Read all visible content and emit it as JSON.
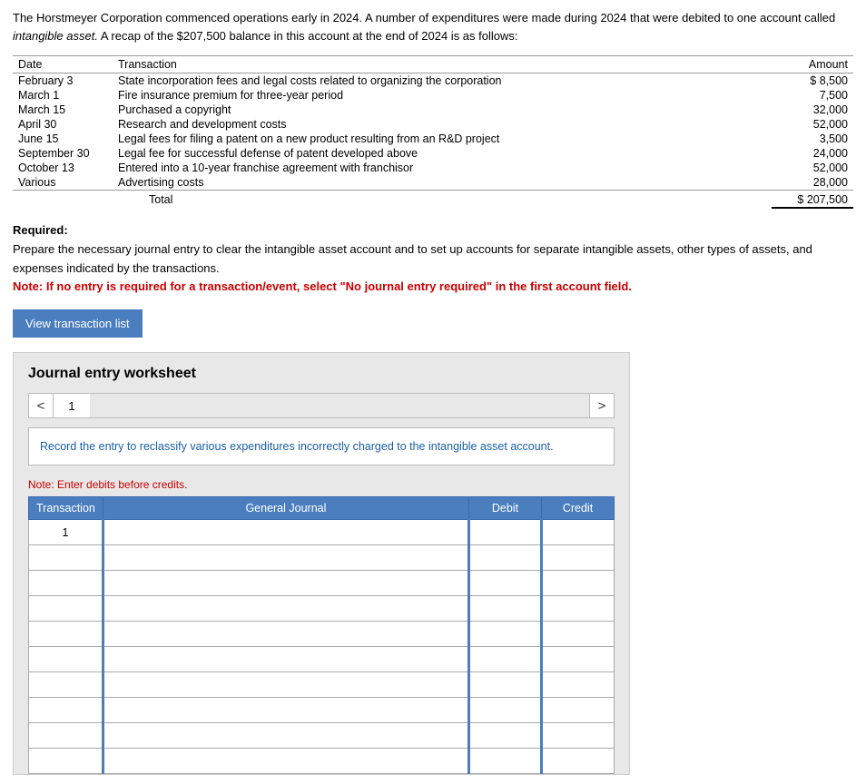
{
  "intro": {
    "text": "The Horstmeyer Corporation commenced operations early in 2024. A number of expenditures were made during 2024 that were debited to one account called intangible asset. A recap of the $207,500 balance in this account at the end of 2024 is as follows:"
  },
  "transaction_table": {
    "headers": [
      "Date",
      "Transaction",
      "Amount"
    ],
    "rows": [
      {
        "date": "February 3",
        "transaction": "State incorporation fees and legal costs related to organizing the corporation",
        "amount": "$ 8,500"
      },
      {
        "date": "March 1",
        "transaction": "Fire insurance premium for three-year period",
        "amount": "7,500"
      },
      {
        "date": "March 15",
        "transaction": "Purchased a copyright",
        "amount": "32,000"
      },
      {
        "date": "April 30",
        "transaction": "Research and development costs",
        "amount": "52,000"
      },
      {
        "date": "June 15",
        "transaction": "Legal fees for filing a patent on a new product resulting from an R&D project",
        "amount": "3,500"
      },
      {
        "date": "September 30",
        "transaction": "Legal fee for successful defense of patent developed above",
        "amount": "24,000"
      },
      {
        "date": "October 13",
        "transaction": "Entered into a 10-year franchise agreement with franchisor",
        "amount": "52,000"
      },
      {
        "date": "Various",
        "transaction": "Advertising costs",
        "amount": "28,000"
      }
    ],
    "total_label": "Total",
    "total_amount": "$ 207,500"
  },
  "required": {
    "label": "Required:",
    "text": "Prepare the necessary journal entry to clear the intangible asset account and to set up accounts for separate intangible assets, other types of assets, and expenses indicated by the transactions.",
    "note": "Note: If no entry is required for a transaction/event, select \"No journal entry required\" in the first account field."
  },
  "view_btn": {
    "label": "View transaction list"
  },
  "worksheet": {
    "title": "Journal entry worksheet",
    "nav": {
      "left_arrow": "<",
      "page_number": "1",
      "right_arrow": ">"
    },
    "description": {
      "part1": "Record the entry to reclassify various expenditures incorrectly charged to the",
      "part2": "intangible asset account."
    },
    "note": "Note: Enter debits before credits.",
    "table": {
      "headers": [
        "Transaction",
        "General Journal",
        "Debit",
        "Credit"
      ],
      "rows": [
        {
          "transaction": "1",
          "gj": "",
          "debit": "",
          "credit": ""
        },
        {
          "transaction": "",
          "gj": "",
          "debit": "",
          "credit": ""
        },
        {
          "transaction": "",
          "gj": "",
          "debit": "",
          "credit": ""
        },
        {
          "transaction": "",
          "gj": "",
          "debit": "",
          "credit": ""
        },
        {
          "transaction": "",
          "gj": "",
          "debit": "",
          "credit": ""
        },
        {
          "transaction": "",
          "gj": "",
          "debit": "",
          "credit": ""
        },
        {
          "transaction": "",
          "gj": "",
          "debit": "",
          "credit": ""
        },
        {
          "transaction": "",
          "gj": "",
          "debit": "",
          "credit": ""
        },
        {
          "transaction": "",
          "gj": "",
          "debit": "",
          "credit": ""
        },
        {
          "transaction": "",
          "gj": "",
          "debit": "",
          "credit": ""
        }
      ]
    }
  }
}
